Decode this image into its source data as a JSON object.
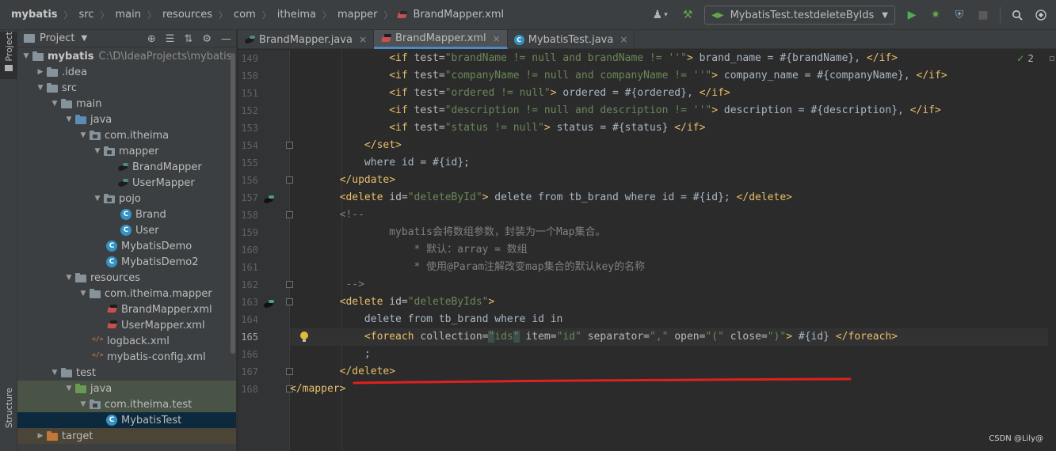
{
  "breadcrumbs": [
    "mybatis",
    "src",
    "main",
    "resources",
    "com",
    "itheima",
    "mapper",
    "BrandMapper.xml"
  ],
  "toolbar": {
    "run_config": "MybatisTest.testdeleteByIds",
    "icons": [
      "user-icon",
      "hammer-icon",
      "run-icon",
      "debug-icon",
      "coverage-icon",
      "stop-icon",
      "search-icon"
    ]
  },
  "left_stripe": {
    "project": "Project",
    "structure": "Structure"
  },
  "project_panel": {
    "title": "Project",
    "tools": [
      "target-icon",
      "collapse-icon",
      "expand-icon",
      "gear-icon",
      "minimize-icon"
    ]
  },
  "tree": [
    {
      "label": "mybatis",
      "path": "C:\\D\\IdeaProjects\\mybatis"
    },
    {
      "label": ".idea"
    },
    {
      "label": "src"
    },
    {
      "label": "main"
    },
    {
      "label": "java"
    },
    {
      "label": "com.itheima"
    },
    {
      "label": "mapper"
    },
    {
      "label": "BrandMapper"
    },
    {
      "label": "UserMapper"
    },
    {
      "label": "pojo"
    },
    {
      "label": "Brand"
    },
    {
      "label": "User"
    },
    {
      "label": "MybatisDemo"
    },
    {
      "label": "MybatisDemo2"
    },
    {
      "label": "resources"
    },
    {
      "label": "com.itheima.mapper"
    },
    {
      "label": "BrandMapper.xml"
    },
    {
      "label": "UserMapper.xml"
    },
    {
      "label": "logback.xml"
    },
    {
      "label": "mybatis-config.xml"
    },
    {
      "label": "test"
    },
    {
      "label": "java"
    },
    {
      "label": "com.itheima.test"
    },
    {
      "label": "MybatisTest"
    },
    {
      "label": "target"
    }
  ],
  "tabs": [
    {
      "label": "BrandMapper.java",
      "close": "×"
    },
    {
      "label": "BrandMapper.xml",
      "close": "×"
    },
    {
      "label": "MybatisTest.java",
      "close": "×"
    }
  ],
  "inspection": {
    "count": "2"
  },
  "code": {
    "line_numbers": [
      "149",
      "150",
      "151",
      "152",
      "153",
      "154",
      "155",
      "156",
      "157",
      "158",
      "159",
      "160",
      "161",
      "162",
      "163",
      "164",
      "165",
      "166",
      "167",
      "168"
    ],
    "current_line": "165"
  },
  "watermark": "CSDN @Lily@",
  "colors": {
    "accent": "#4a88c7",
    "tag": "#e8bf6a",
    "string": "#6a8759",
    "comment": "#808080",
    "underline": "#e0201f"
  }
}
